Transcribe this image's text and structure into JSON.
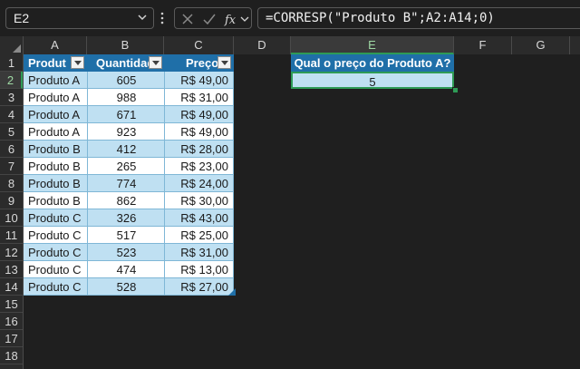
{
  "formula_bar": {
    "name_box": "E2",
    "formula": "=CORRESP(\"Produto B\";A2:A14;0)",
    "fx_label": "fx"
  },
  "columns": [
    "A",
    "B",
    "C",
    "D",
    "E",
    "F",
    "G"
  ],
  "rows": [
    "1",
    "2",
    "3",
    "4",
    "5",
    "6",
    "7",
    "8",
    "9",
    "10",
    "11",
    "12",
    "13",
    "14",
    "15",
    "16",
    "17",
    "18"
  ],
  "table": {
    "headers": {
      "produto": "Produt",
      "quantidade": "Quantidad",
      "preco": "Preço"
    },
    "rows": [
      {
        "produto": "Produto A",
        "quantidade": "605",
        "preco": "R$ 49,00"
      },
      {
        "produto": "Produto A",
        "quantidade": "988",
        "preco": "R$ 31,00"
      },
      {
        "produto": "Produto A",
        "quantidade": "671",
        "preco": "R$ 49,00"
      },
      {
        "produto": "Produto A",
        "quantidade": "923",
        "preco": "R$ 49,00"
      },
      {
        "produto": "Produto B",
        "quantidade": "412",
        "preco": "R$ 28,00"
      },
      {
        "produto": "Produto B",
        "quantidade": "265",
        "preco": "R$ 23,00"
      },
      {
        "produto": "Produto B",
        "quantidade": "774",
        "preco": "R$ 24,00"
      },
      {
        "produto": "Produto B",
        "quantidade": "862",
        "preco": "R$ 30,00"
      },
      {
        "produto": "Produto C",
        "quantidade": "326",
        "preco": "R$ 43,00"
      },
      {
        "produto": "Produto C",
        "quantidade": "517",
        "preco": "R$ 25,00"
      },
      {
        "produto": "Produto C",
        "quantidade": "523",
        "preco": "R$ 31,00"
      },
      {
        "produto": "Produto C",
        "quantidade": "474",
        "preco": "R$ 13,00"
      },
      {
        "produto": "Produto C",
        "quantidade": "528",
        "preco": "R$ 27,00"
      }
    ]
  },
  "question": {
    "label": "Qual o preço do Produto A?",
    "result": "5"
  },
  "colors": {
    "table_header": "#1f6fa8",
    "band_light": "#bfe0f2",
    "selection": "#2e9b56"
  },
  "icons": [
    "chevron-down-icon",
    "more-vertical-icon",
    "cancel-icon",
    "enter-check-icon",
    "fx-icon",
    "filter-dropdown-icon"
  ]
}
